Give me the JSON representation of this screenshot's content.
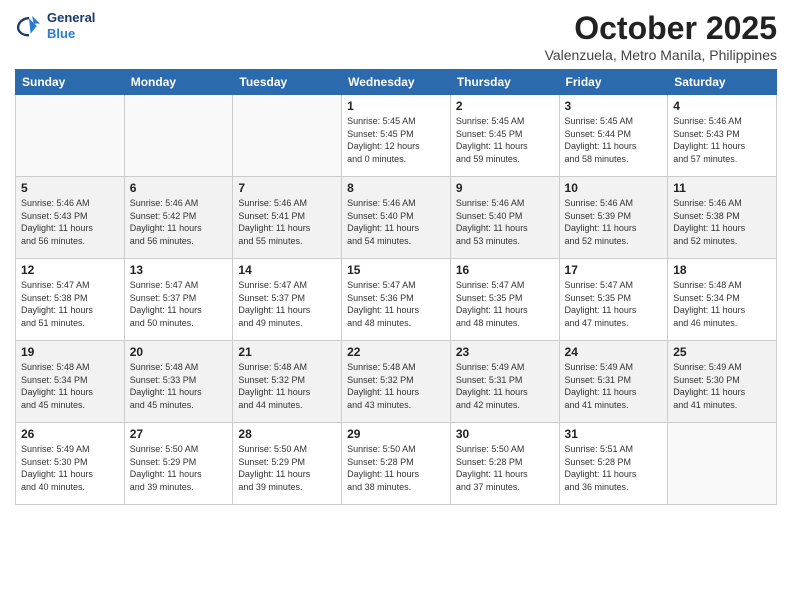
{
  "logo": {
    "line1": "General",
    "line2": "Blue"
  },
  "title": "October 2025",
  "subtitle": "Valenzuela, Metro Manila, Philippines",
  "days_of_week": [
    "Sunday",
    "Monday",
    "Tuesday",
    "Wednesday",
    "Thursday",
    "Friday",
    "Saturday"
  ],
  "weeks": [
    {
      "shaded": false,
      "days": [
        {
          "number": "",
          "info": ""
        },
        {
          "number": "",
          "info": ""
        },
        {
          "number": "",
          "info": ""
        },
        {
          "number": "1",
          "info": "Sunrise: 5:45 AM\nSunset: 5:45 PM\nDaylight: 12 hours\nand 0 minutes."
        },
        {
          "number": "2",
          "info": "Sunrise: 5:45 AM\nSunset: 5:45 PM\nDaylight: 11 hours\nand 59 minutes."
        },
        {
          "number": "3",
          "info": "Sunrise: 5:45 AM\nSunset: 5:44 PM\nDaylight: 11 hours\nand 58 minutes."
        },
        {
          "number": "4",
          "info": "Sunrise: 5:46 AM\nSunset: 5:43 PM\nDaylight: 11 hours\nand 57 minutes."
        }
      ]
    },
    {
      "shaded": true,
      "days": [
        {
          "number": "5",
          "info": "Sunrise: 5:46 AM\nSunset: 5:43 PM\nDaylight: 11 hours\nand 56 minutes."
        },
        {
          "number": "6",
          "info": "Sunrise: 5:46 AM\nSunset: 5:42 PM\nDaylight: 11 hours\nand 56 minutes."
        },
        {
          "number": "7",
          "info": "Sunrise: 5:46 AM\nSunset: 5:41 PM\nDaylight: 11 hours\nand 55 minutes."
        },
        {
          "number": "8",
          "info": "Sunrise: 5:46 AM\nSunset: 5:40 PM\nDaylight: 11 hours\nand 54 minutes."
        },
        {
          "number": "9",
          "info": "Sunrise: 5:46 AM\nSunset: 5:40 PM\nDaylight: 11 hours\nand 53 minutes."
        },
        {
          "number": "10",
          "info": "Sunrise: 5:46 AM\nSunset: 5:39 PM\nDaylight: 11 hours\nand 52 minutes."
        },
        {
          "number": "11",
          "info": "Sunrise: 5:46 AM\nSunset: 5:38 PM\nDaylight: 11 hours\nand 52 minutes."
        }
      ]
    },
    {
      "shaded": false,
      "days": [
        {
          "number": "12",
          "info": "Sunrise: 5:47 AM\nSunset: 5:38 PM\nDaylight: 11 hours\nand 51 minutes."
        },
        {
          "number": "13",
          "info": "Sunrise: 5:47 AM\nSunset: 5:37 PM\nDaylight: 11 hours\nand 50 minutes."
        },
        {
          "number": "14",
          "info": "Sunrise: 5:47 AM\nSunset: 5:37 PM\nDaylight: 11 hours\nand 49 minutes."
        },
        {
          "number": "15",
          "info": "Sunrise: 5:47 AM\nSunset: 5:36 PM\nDaylight: 11 hours\nand 48 minutes."
        },
        {
          "number": "16",
          "info": "Sunrise: 5:47 AM\nSunset: 5:35 PM\nDaylight: 11 hours\nand 48 minutes."
        },
        {
          "number": "17",
          "info": "Sunrise: 5:47 AM\nSunset: 5:35 PM\nDaylight: 11 hours\nand 47 minutes."
        },
        {
          "number": "18",
          "info": "Sunrise: 5:48 AM\nSunset: 5:34 PM\nDaylight: 11 hours\nand 46 minutes."
        }
      ]
    },
    {
      "shaded": true,
      "days": [
        {
          "number": "19",
          "info": "Sunrise: 5:48 AM\nSunset: 5:34 PM\nDaylight: 11 hours\nand 45 minutes."
        },
        {
          "number": "20",
          "info": "Sunrise: 5:48 AM\nSunset: 5:33 PM\nDaylight: 11 hours\nand 45 minutes."
        },
        {
          "number": "21",
          "info": "Sunrise: 5:48 AM\nSunset: 5:32 PM\nDaylight: 11 hours\nand 44 minutes."
        },
        {
          "number": "22",
          "info": "Sunrise: 5:48 AM\nSunset: 5:32 PM\nDaylight: 11 hours\nand 43 minutes."
        },
        {
          "number": "23",
          "info": "Sunrise: 5:49 AM\nSunset: 5:31 PM\nDaylight: 11 hours\nand 42 minutes."
        },
        {
          "number": "24",
          "info": "Sunrise: 5:49 AM\nSunset: 5:31 PM\nDaylight: 11 hours\nand 41 minutes."
        },
        {
          "number": "25",
          "info": "Sunrise: 5:49 AM\nSunset: 5:30 PM\nDaylight: 11 hours\nand 41 minutes."
        }
      ]
    },
    {
      "shaded": false,
      "days": [
        {
          "number": "26",
          "info": "Sunrise: 5:49 AM\nSunset: 5:30 PM\nDaylight: 11 hours\nand 40 minutes."
        },
        {
          "number": "27",
          "info": "Sunrise: 5:50 AM\nSunset: 5:29 PM\nDaylight: 11 hours\nand 39 minutes."
        },
        {
          "number": "28",
          "info": "Sunrise: 5:50 AM\nSunset: 5:29 PM\nDaylight: 11 hours\nand 39 minutes."
        },
        {
          "number": "29",
          "info": "Sunrise: 5:50 AM\nSunset: 5:28 PM\nDaylight: 11 hours\nand 38 minutes."
        },
        {
          "number": "30",
          "info": "Sunrise: 5:50 AM\nSunset: 5:28 PM\nDaylight: 11 hours\nand 37 minutes."
        },
        {
          "number": "31",
          "info": "Sunrise: 5:51 AM\nSunset: 5:28 PM\nDaylight: 11 hours\nand 36 minutes."
        },
        {
          "number": "",
          "info": ""
        }
      ]
    }
  ]
}
